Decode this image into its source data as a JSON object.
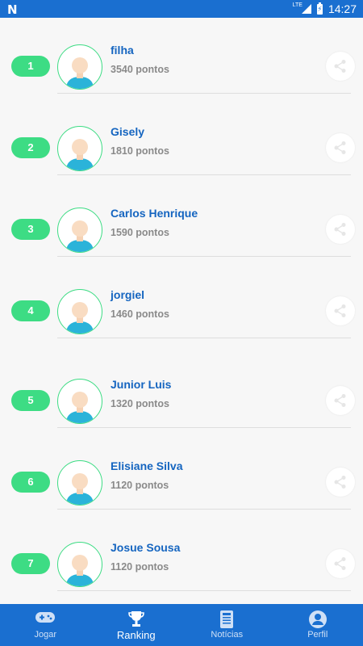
{
  "status_bar": {
    "logo": "N",
    "network": "LTE",
    "time": "14:27"
  },
  "ranking": [
    {
      "rank": "1",
      "name": "filha",
      "points": "3540 pontos"
    },
    {
      "rank": "2",
      "name": "Gisely",
      "points": "1810 pontos"
    },
    {
      "rank": "3",
      "name": "Carlos Henrique",
      "points": "1590 pontos"
    },
    {
      "rank": "4",
      "name": "jorgiel",
      "points": "1460 pontos"
    },
    {
      "rank": "5",
      "name": "Junior Luis",
      "points": "1320 pontos"
    },
    {
      "rank": "6",
      "name": "Elisiane Silva",
      "points": "1120 pontos"
    },
    {
      "rank": "7",
      "name": "Josue Sousa",
      "points": "1120 pontos"
    }
  ],
  "bottom_nav": {
    "items": [
      {
        "label": "Jogar",
        "icon": "gamepad-icon"
      },
      {
        "label": "Ranking",
        "icon": "trophy-icon"
      },
      {
        "label": "Notícias",
        "icon": "newspaper-icon"
      },
      {
        "label": "Perfil",
        "icon": "profile-icon"
      }
    ],
    "active": "Ranking"
  },
  "colors": {
    "primary": "#1a6fd0",
    "accent": "#3ddc84",
    "name_text": "#1565c0",
    "points_text": "#8a8a8a"
  }
}
